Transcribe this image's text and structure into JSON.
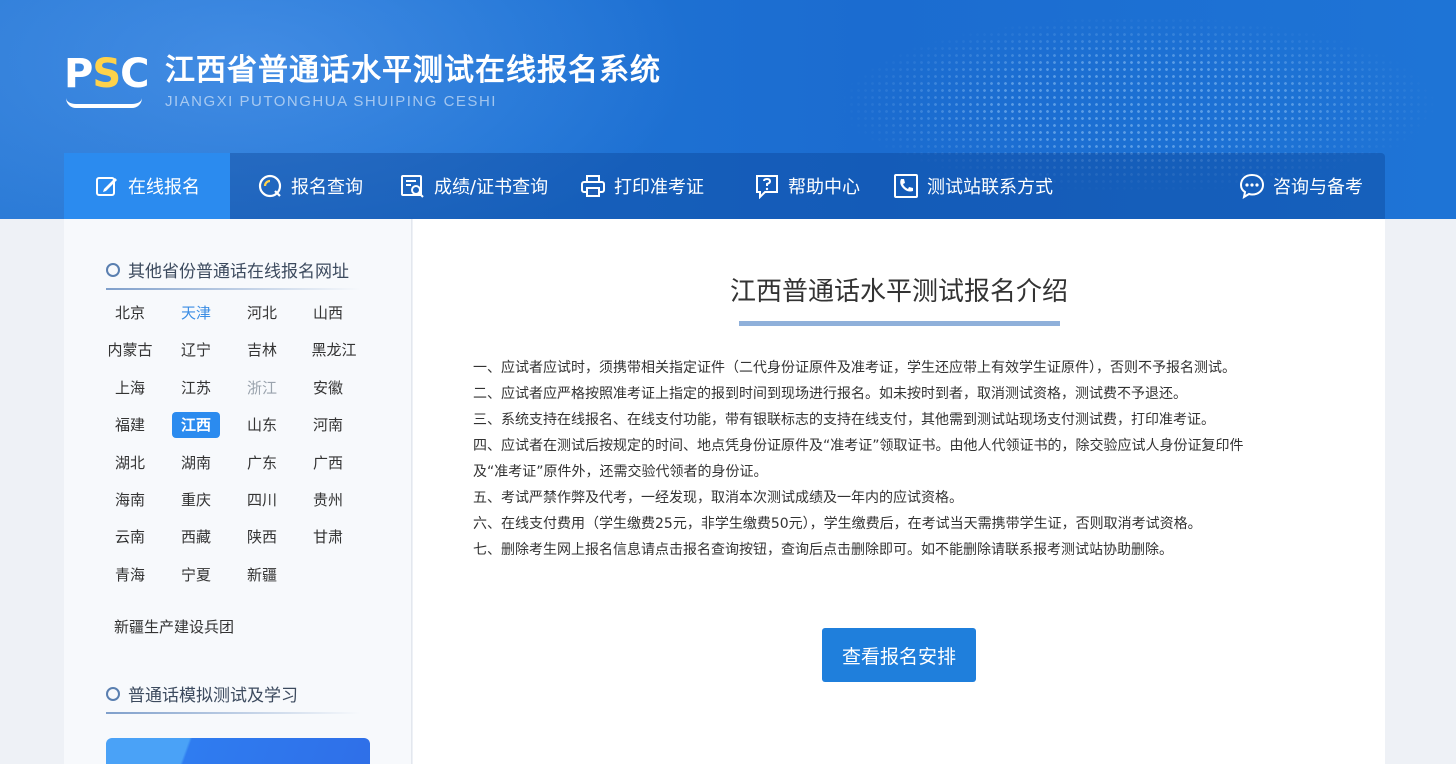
{
  "header": {
    "logo_text": "PSC",
    "title": "江西省普通话水平测试在线报名系统",
    "subtitle": "JIANGXI PUTONGHUA SHUIPING CESHI"
  },
  "nav": {
    "items": [
      {
        "label": "在线报名",
        "icon": "edit-icon",
        "active": true
      },
      {
        "label": "报名查询",
        "icon": "search-circle-icon"
      },
      {
        "label": "成绩/证书查询",
        "icon": "certificate-search-icon"
      },
      {
        "label": "打印准考证",
        "icon": "printer-icon"
      },
      {
        "label": "帮助中心",
        "icon": "help-icon"
      },
      {
        "label": "测试站联系方式",
        "icon": "phone-icon"
      },
      {
        "label": "咨询与备考",
        "icon": "chat-icon"
      }
    ]
  },
  "sidebar": {
    "provinces_title": "其他省份普通话在线报名网址",
    "provinces": [
      "北京",
      "天津",
      "河北",
      "山西",
      "内蒙古",
      "辽宁",
      "吉林",
      "黑龙江",
      "上海",
      "江苏",
      "浙江",
      "安徽",
      "福建",
      "江西",
      "山东",
      "河南",
      "湖北",
      "湖南",
      "广东",
      "广西",
      "海南",
      "重庆",
      "四川",
      "贵州",
      "云南",
      "西藏",
      "陕西",
      "甘肃",
      "青海",
      "宁夏",
      "新疆"
    ],
    "provinces_extra": "新疆生产建设兵团",
    "highlighted_province": "天津",
    "disabled_province": "浙江",
    "selected_province": "江西",
    "simulation_title": "普通话模拟测试及学习"
  },
  "main": {
    "title": "江西普通话水平测试报名介绍",
    "rules": [
      "一、应试者应试时，须携带相关指定证件（二代身份证原件及准考证，学生还应带上有效学生证原件），否则不予报名测试。",
      "二、应试者应严格按照准考证上指定的报到时间到现场进行报名。如未按时到者，取消测试资格，测试费不予退还。",
      "三、系统支持在线报名、在线支付功能，带有银联标志的支持在线支付，其他需到测试站现场支付测试费，打印准考证。",
      "四、应试者在测试后按规定的时间、地点凭身份证原件及“准考证”领取证书。由他人代领证书的，除交验应试人身份证复印件",
      "及“准考证”原件外，还需交验代领者的身份证。",
      "五、考试严禁作弊及代考，一经发现，取消本次测试成绩及一年内的应试资格。",
      "六、在线支付费用（学生缴费25元，非学生缴费50元），学生缴费后，在考试当天需携带学生证，否则取消考试资格。",
      "七、删除考生网上报名信息请点击报名查询按钮，查询后点击删除即可。如不能删除请联系报考测试站协助删除。"
    ],
    "button_label": "查看报名安排"
  },
  "colors": {
    "accent": "#2b8bef",
    "button": "#1f7fdc",
    "banner": "#1f73d4"
  }
}
